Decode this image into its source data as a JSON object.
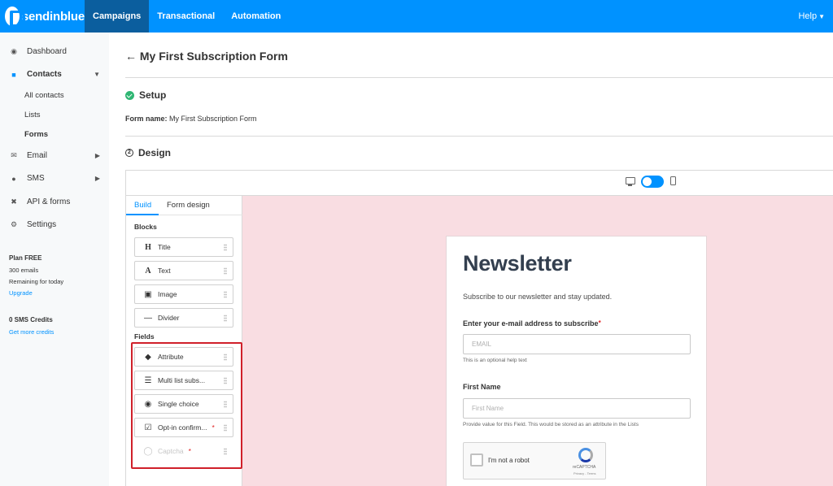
{
  "topbar": {
    "logo_text": "sendinblue",
    "tabs": [
      {
        "label": "Campaigns",
        "active": true
      },
      {
        "label": "Transactional",
        "active": false
      },
      {
        "label": "Automation",
        "active": false
      }
    ],
    "help_label": "Help"
  },
  "sidebar": {
    "items": [
      {
        "label": "Dashboard",
        "icon": "dashboard-icon"
      },
      {
        "label": "Contacts",
        "icon": "contacts-icon"
      },
      {
        "label": "Email",
        "icon": "email-icon"
      },
      {
        "label": "SMS",
        "icon": "sms-icon"
      },
      {
        "label": "API & forms",
        "icon": "wrench-icon"
      },
      {
        "label": "Settings",
        "icon": "gear-icon"
      }
    ],
    "contacts_sub": [
      "All contacts",
      "Lists",
      "Forms"
    ],
    "plan": {
      "title": "Plan FREE",
      "emails": "300 emails",
      "remaining": "Remaining for today",
      "upgrade": "Upgrade",
      "sms_credits": "0 SMS Credits",
      "get_more": "Get more credits"
    }
  },
  "main": {
    "page_title": "My First Subscription Form",
    "setup": {
      "title": "Setup",
      "form_name_label": "Form name:",
      "form_name_value": "My First Subscription Form"
    },
    "design": {
      "title": "Design",
      "step_number": "2",
      "tabs": [
        "Build",
        "Form design"
      ],
      "blocks_label": "Blocks",
      "blocks": [
        "Title",
        "Text",
        "Image",
        "Divider"
      ],
      "fields_label": "Fields",
      "fields": [
        "Attribute",
        "Multi list subs...",
        "Single choice",
        "Opt-in confirm...",
        "Captcha"
      ],
      "required_marker": "*"
    },
    "preview": {
      "title": "Newsletter",
      "subtitle": "Subscribe to our newsletter and stay updated.",
      "email_label": "Enter your e-mail address to subscribe",
      "email_placeholder": "EMAIL",
      "email_help": "This is an optional help text",
      "firstname_label": "First Name",
      "firstname_placeholder": "First Name",
      "firstname_help": "Provide value for this Field. This would be stored as an attribute in the Lists",
      "captcha_text": "I'm not a robot",
      "captcha_brand": "reCAPTCHA",
      "captcha_terms": "Privacy - Terms"
    }
  },
  "colors": {
    "brand": "#0092ff",
    "active_tab": "#0b5e9e",
    "success": "#2fb673",
    "preview_bg": "#f9dde2",
    "highlight": "#d0202a"
  }
}
